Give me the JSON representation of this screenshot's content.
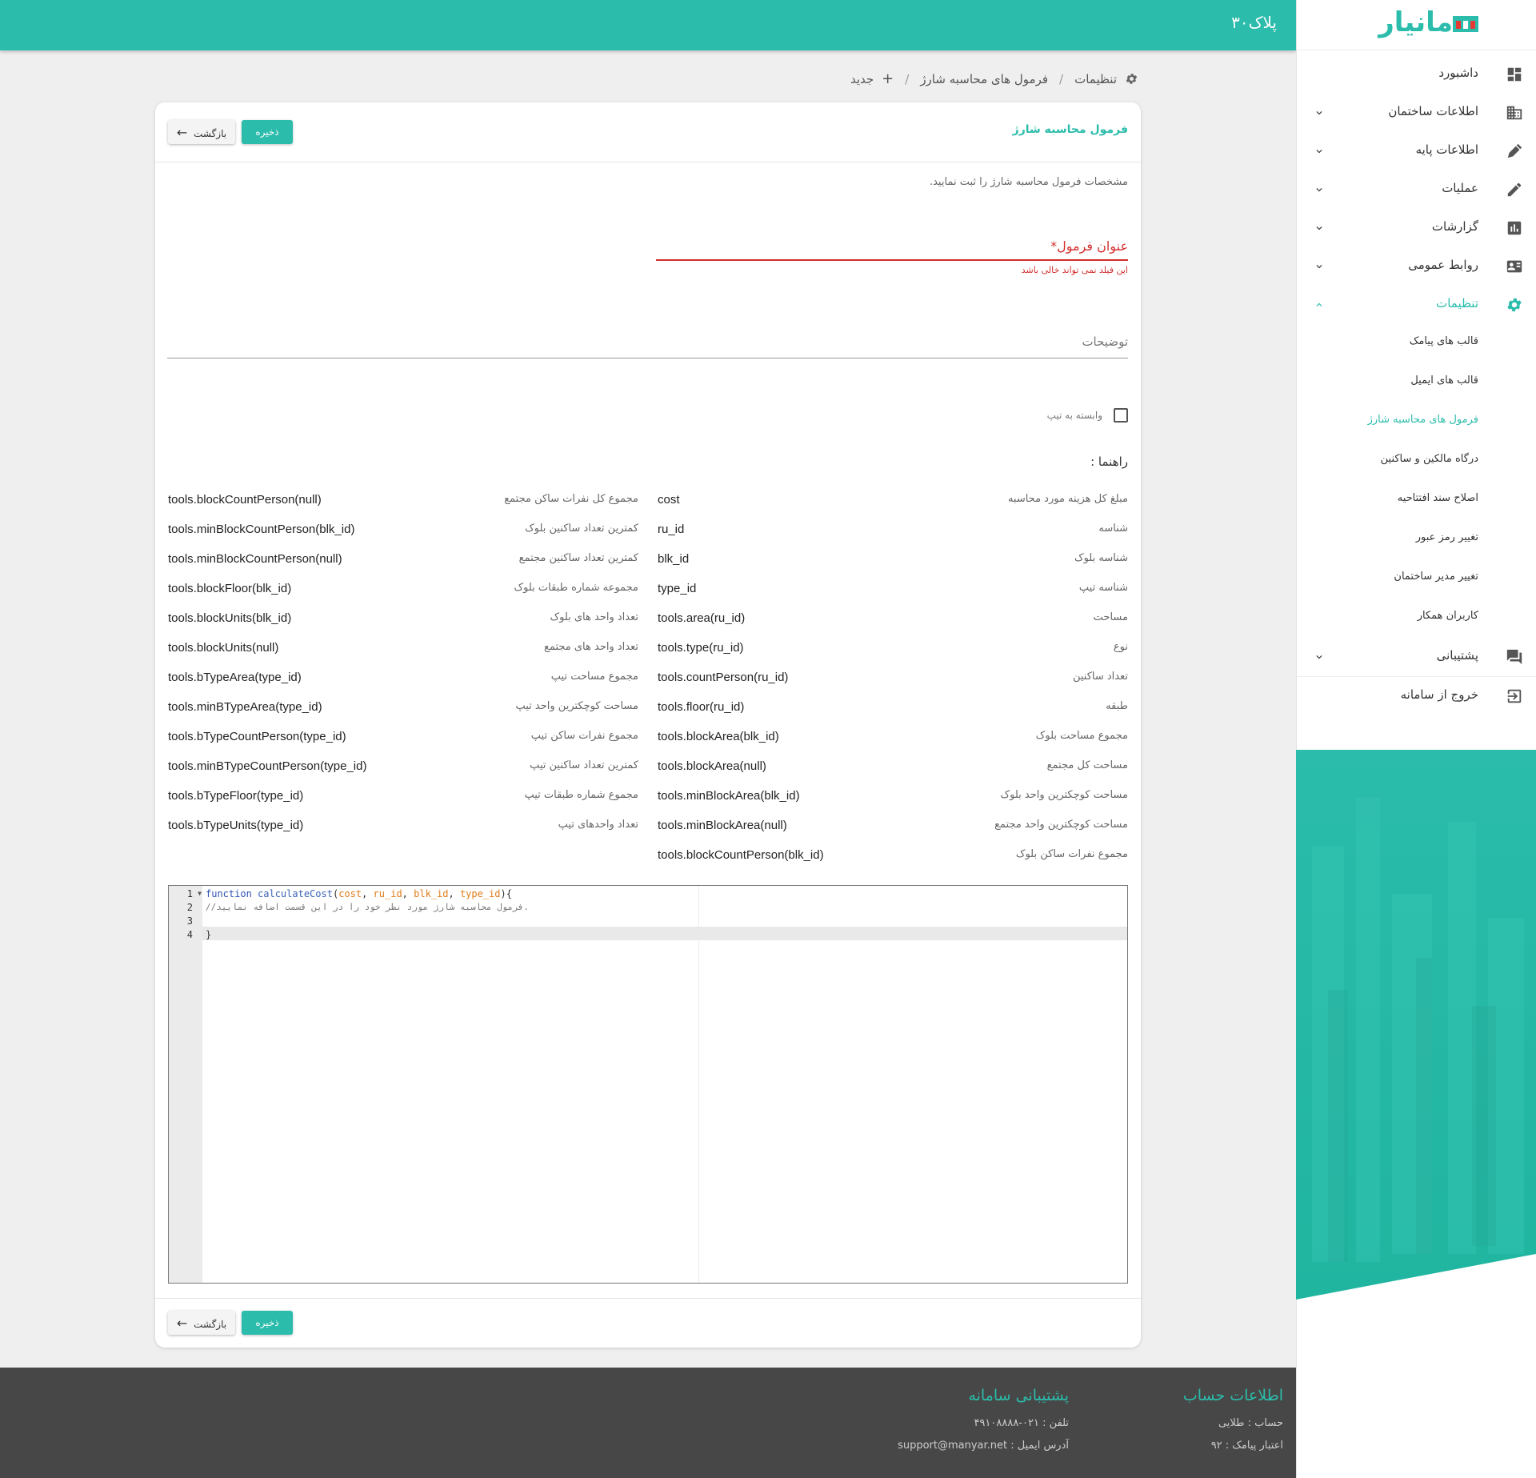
{
  "topbar": {
    "plate": "پلاک۳۰"
  },
  "brand": {
    "name": "مانیار",
    "colors": {
      "accent": "#2bbcab",
      "logo_red": "#e53935"
    }
  },
  "sidebar": {
    "items": [
      {
        "label": "داشبورد",
        "icon": "dashboard-icon",
        "has_chevron": false
      },
      {
        "label": "اطلاعات ساختمان",
        "icon": "building-icon",
        "has_chevron": true
      },
      {
        "label": "اطلاعات پایه",
        "icon": "pen-tool-icon",
        "has_chevron": true
      },
      {
        "label": "عملیات",
        "icon": "pencil-icon",
        "has_chevron": true
      },
      {
        "label": "گزارشات",
        "icon": "chart-icon",
        "has_chevron": true
      },
      {
        "label": "روابط عمومی",
        "icon": "contact-card-icon",
        "has_chevron": true
      },
      {
        "label": "تنظیمات",
        "icon": "gear-icon",
        "has_chevron": true,
        "expanded": true
      },
      {
        "label": "پشتیبانی",
        "icon": "chat-icon",
        "has_chevron": true
      },
      {
        "label": "خروج از سامانه",
        "icon": "logout-icon",
        "has_chevron": false
      }
    ],
    "settings_sub": [
      {
        "label": "قالب های پیامک"
      },
      {
        "label": "قالب های ایمیل"
      },
      {
        "label": "فرمول های محاسبه شارژ",
        "active": true
      },
      {
        "label": "درگاه مالکین و ساکنین"
      },
      {
        "label": "اصلاح سند افتتاحیه"
      },
      {
        "label": "تغییر رمز عبور"
      },
      {
        "label": "تغییر مدیر ساختمان"
      },
      {
        "label": "کاربران همکار"
      }
    ]
  },
  "breadcrumb": {
    "settings": "تنظیمات",
    "formulas": "فرمول های محاسبه شارژ",
    "new": "جدید",
    "separator": "/"
  },
  "card": {
    "title": "فرمول محاسبه شارژ",
    "save_label": "ذخیره",
    "back_label": "بازگشت",
    "hint": "مشخصات فرمول محاسبه شارژ را ثبت نمایید.",
    "title_field_label": "عنوان فرمول*",
    "title_field_error": "این فیلد نمی تواند خالی باشد",
    "description_label": "توضیحات",
    "type_checkbox_label": "وابسته به تیپ",
    "guide_title": "راهنما :"
  },
  "guide": {
    "right": [
      {
        "desc": "مبلغ کل هزینه مورد محاسبه",
        "code": "cost"
      },
      {
        "desc": "شناسه",
        "code": "ru_id"
      },
      {
        "desc": "شناسه بلوک",
        "code": "blk_id"
      },
      {
        "desc": "شناسه تیپ",
        "code": "type_id"
      },
      {
        "desc": "مساحت",
        "code": "tools.area(ru_id)"
      },
      {
        "desc": "نوع",
        "code": "tools.type(ru_id)"
      },
      {
        "desc": "تعداد ساکنین",
        "code": "tools.countPerson(ru_id)"
      },
      {
        "desc": "طبقه",
        "code": "tools.floor(ru_id)"
      },
      {
        "desc": "مجموع مساحت بلوک",
        "code": "tools.blockArea(blk_id)"
      },
      {
        "desc": "مساحت کل مجتمع",
        "code": "tools.blockArea(null)"
      },
      {
        "desc": "مساحت کوچکترین واحد بلوک",
        "code": "tools.minBlockArea(blk_id)"
      },
      {
        "desc": "مساحت کوچکترین واحد مجتمع",
        "code": "tools.minBlockArea(null)"
      },
      {
        "desc": "مجموع نفرات ساکن بلوک",
        "code": "tools.blockCountPerson(blk_id)"
      }
    ],
    "left": [
      {
        "desc": "مجموع کل نفرات ساکن مجتمع",
        "code": "tools.blockCountPerson(null)"
      },
      {
        "desc": "کمترین تعداد ساکنین بلوک",
        "code": "tools.minBlockCountPerson(blk_id)"
      },
      {
        "desc": "کمترین تعداد ساکنین مجتمع",
        "code": "tools.minBlockCountPerson(null)"
      },
      {
        "desc": "مجموعه شماره طبقات بلوک",
        "code": "tools.blockFloor(blk_id)"
      },
      {
        "desc": "تعداد واحد های بلوک",
        "code": "tools.blockUnits(blk_id)"
      },
      {
        "desc": "تعداد واحد های مجتمع",
        "code": "tools.blockUnits(null)"
      },
      {
        "desc": "مجموع مساحت تیپ",
        "code": "tools.bTypeArea(type_id)"
      },
      {
        "desc": "مساحت کوچکترین واحد تیپ",
        "code": "tools.minBTypeArea(type_id)"
      },
      {
        "desc": "مجموع نفرات ساکن تیپ",
        "code": "tools.bTypeCountPerson(type_id)"
      },
      {
        "desc": "کمترین تعداد ساکنین تیپ",
        "code": "tools.minBTypeCountPerson(type_id)"
      },
      {
        "desc": "مجموع شماره طبقات تیپ",
        "code": "tools.bTypeFloor(type_id)"
      },
      {
        "desc": "تعداد واحدهای تیپ",
        "code": "tools.bTypeUnits(type_id)"
      }
    ]
  },
  "editor": {
    "line_numbers": [
      "1",
      "2",
      "3",
      "4"
    ],
    "kw_function": "function",
    "fn_name": "calculateCost",
    "params": [
      "cost",
      "ru_id",
      "blk_id",
      "type_id"
    ],
    "comment": "//فرمول محاسبه شارژ مورد نظر خود را در این قسمت اضافه نمایید.",
    "closing": "}"
  },
  "footer": {
    "account_title": "اطلاعات حساب",
    "account_line1": "حساب : طلایی",
    "account_line2": "اعتبار پیامک : ۹۲",
    "support_title": "پشتیبانی سامانه",
    "support_phone": "تلفن : ۰۲۱-۴۹۱۰۸۸۸۸",
    "support_email_label": "آدرس ایمیل :",
    "support_email": "support@manyar.net"
  }
}
